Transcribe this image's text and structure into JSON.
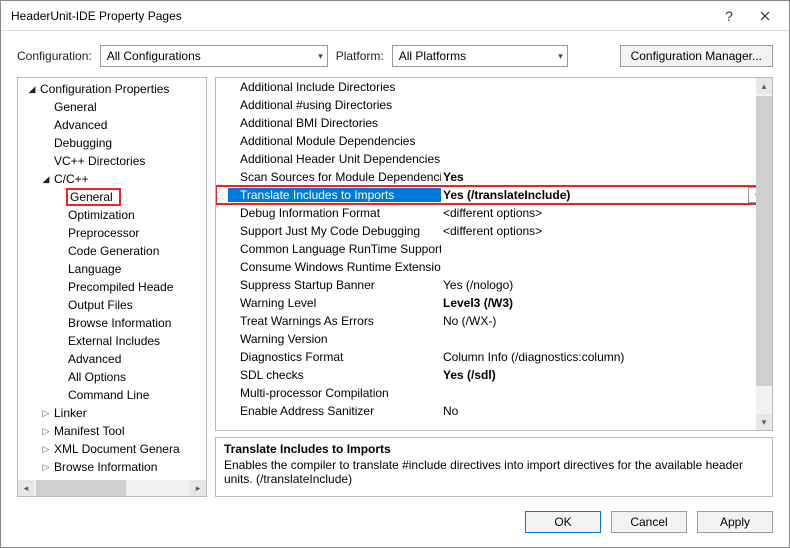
{
  "title": "HeaderUnit-IDE Property Pages",
  "toprow": {
    "configuration_label": "Configuration:",
    "configuration_value": "All Configurations",
    "platform_label": "Platform:",
    "platform_value": "All Platforms",
    "manager_btn": "Configuration Manager..."
  },
  "tree": [
    {
      "lvl": 0,
      "tw": "open",
      "txt": "Configuration Properties"
    },
    {
      "lvl": 1,
      "tw": "",
      "txt": "General"
    },
    {
      "lvl": 1,
      "tw": "",
      "txt": "Advanced"
    },
    {
      "lvl": 1,
      "tw": "",
      "txt": "Debugging"
    },
    {
      "lvl": 1,
      "tw": "",
      "txt": "VC++ Directories"
    },
    {
      "lvl": 1,
      "tw": "open",
      "txt": "C/C++"
    },
    {
      "lvl": 2,
      "tw": "",
      "txt": "General",
      "hl": true
    },
    {
      "lvl": 2,
      "tw": "",
      "txt": "Optimization"
    },
    {
      "lvl": 2,
      "tw": "",
      "txt": "Preprocessor"
    },
    {
      "lvl": 2,
      "tw": "",
      "txt": "Code Generation"
    },
    {
      "lvl": 2,
      "tw": "",
      "txt": "Language"
    },
    {
      "lvl": 2,
      "tw": "",
      "txt": "Precompiled Heade"
    },
    {
      "lvl": 2,
      "tw": "",
      "txt": "Output Files"
    },
    {
      "lvl": 2,
      "tw": "",
      "txt": "Browse Information"
    },
    {
      "lvl": 2,
      "tw": "",
      "txt": "External Includes"
    },
    {
      "lvl": 2,
      "tw": "",
      "txt": "Advanced"
    },
    {
      "lvl": 2,
      "tw": "",
      "txt": "All Options"
    },
    {
      "lvl": 2,
      "tw": "",
      "txt": "Command Line"
    },
    {
      "lvl": 1,
      "tw": "closed",
      "txt": "Linker"
    },
    {
      "lvl": 1,
      "tw": "closed",
      "txt": "Manifest Tool"
    },
    {
      "lvl": 1,
      "tw": "closed",
      "txt": "XML Document Genera"
    },
    {
      "lvl": 1,
      "tw": "closed",
      "txt": "Browse Information"
    }
  ],
  "grid": [
    {
      "label": "Additional Include Directories",
      "val": ""
    },
    {
      "label": "Additional #using Directories",
      "val": ""
    },
    {
      "label": "Additional BMI Directories",
      "val": ""
    },
    {
      "label": "Additional Module Dependencies",
      "val": ""
    },
    {
      "label": "Additional Header Unit Dependencies",
      "val": ""
    },
    {
      "label": "Scan Sources for Module Dependencies",
      "val": "Yes",
      "bold": true
    },
    {
      "label": "Translate Includes to Imports",
      "val": "Yes (/translateInclude)",
      "sel": true
    },
    {
      "label": "Debug Information Format",
      "val": "<different options>"
    },
    {
      "label": "Support Just My Code Debugging",
      "val": "<different options>"
    },
    {
      "label": "Common Language RunTime Support",
      "val": ""
    },
    {
      "label": "Consume Windows Runtime Extension",
      "val": ""
    },
    {
      "label": "Suppress Startup Banner",
      "val": "Yes (/nologo)"
    },
    {
      "label": "Warning Level",
      "val": "Level3 (/W3)",
      "bold": true
    },
    {
      "label": "Treat Warnings As Errors",
      "val": "No (/WX-)"
    },
    {
      "label": "Warning Version",
      "val": ""
    },
    {
      "label": "Diagnostics Format",
      "val": "Column Info (/diagnostics:column)"
    },
    {
      "label": "SDL checks",
      "val": "Yes (/sdl)",
      "bold": true
    },
    {
      "label": "Multi-processor Compilation",
      "val": ""
    },
    {
      "label": "Enable Address Sanitizer",
      "val": "No"
    }
  ],
  "desc": {
    "title": "Translate Includes to Imports",
    "body": "Enables the compiler to translate #include directives into import directives for the available header units. (/translateInclude)"
  },
  "buttons": {
    "ok": "OK",
    "cancel": "Cancel",
    "apply": "Apply"
  }
}
